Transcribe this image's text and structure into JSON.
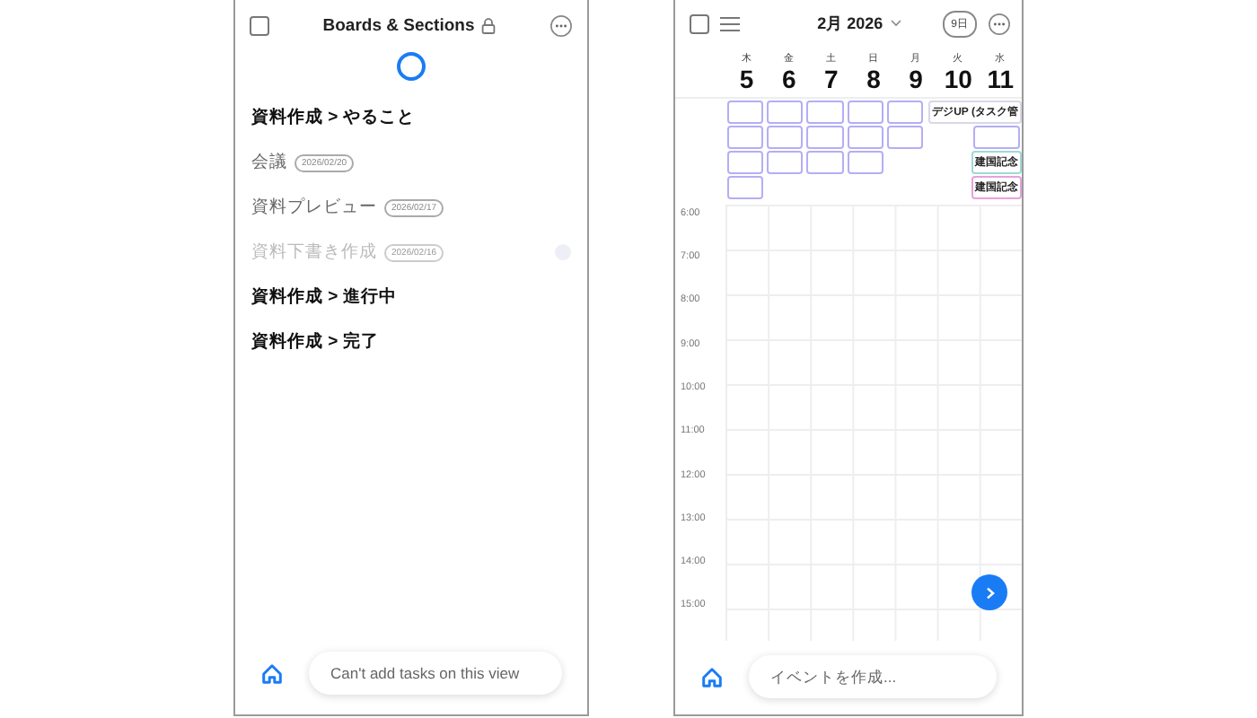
{
  "boards_screen": {
    "select_all": {
      "checked": false
    },
    "title": "Boards & Sections",
    "items": [
      {
        "kind": "section",
        "label": "資料作成 > やること"
      },
      {
        "kind": "task",
        "label": "会議",
        "date": "2026/02/20",
        "dimmed": false
      },
      {
        "kind": "task",
        "label": "資料プレビュー",
        "date": "2026/02/17",
        "dimmed": false
      },
      {
        "kind": "task",
        "label": "資料下書き作成",
        "date": "2026/02/16",
        "dimmed": true
      },
      {
        "kind": "section",
        "label": "資料作成 > 進行中"
      },
      {
        "kind": "section",
        "label": "資料作成 > 完了"
      }
    ],
    "bottom_bar": {
      "placeholder": "Can't add tasks on this view"
    }
  },
  "calendar_screen": {
    "select_all": {
      "checked": false
    },
    "month": "2月 2026",
    "view": "9日",
    "days": [
      {
        "weekday": "木",
        "date": "5"
      },
      {
        "weekday": "金",
        "date": "6"
      },
      {
        "weekday": "土",
        "date": "7"
      },
      {
        "weekday": "日",
        "date": "8"
      },
      {
        "weekday": "月",
        "date": "9"
      },
      {
        "weekday": "火",
        "date": "10"
      },
      {
        "weekday": "水",
        "date": "11"
      }
    ],
    "all_day_rows": [
      [
        {
          "kind": "event",
          "color": "#b4aef6"
        },
        {
          "kind": "event",
          "color": "#b4aef6"
        },
        {
          "kind": "event",
          "color": "#b4aef6"
        },
        {
          "kind": "event",
          "color": "#b4aef6"
        },
        {
          "kind": "event",
          "color": "#b4aef6"
        },
        {
          "kind": "wide",
          "color": "#d9d7e6",
          "text": "デジUP (タスク管"
        }
      ],
      [
        {
          "kind": "event",
          "color": "#b4aef6"
        },
        {
          "kind": "event",
          "color": "#b4aef6"
        },
        {
          "kind": "event",
          "color": "#b4aef6"
        },
        {
          "kind": "event",
          "color": "#b4aef6"
        },
        {
          "kind": "event",
          "color": "#b4aef6"
        },
        {
          "kind": "gap"
        },
        {
          "kind": "event",
          "color": "#b4aef6"
        }
      ],
      [
        {
          "kind": "event",
          "color": "#b4aef6"
        },
        {
          "kind": "event",
          "color": "#b4aef6"
        },
        {
          "kind": "event",
          "color": "#b4aef6"
        },
        {
          "kind": "event",
          "color": "#b4aef6"
        },
        {
          "kind": "gap"
        },
        {
          "kind": "gap"
        },
        {
          "kind": "event",
          "color": "#9fd8d8",
          "text": "建国記念"
        }
      ],
      [
        {
          "kind": "event",
          "color": "#b4aef6"
        },
        {
          "kind": "gap"
        },
        {
          "kind": "gap"
        },
        {
          "kind": "gap"
        },
        {
          "kind": "gap"
        },
        {
          "kind": "gap"
        },
        {
          "kind": "event",
          "color": "#e6a2dc",
          "text": "建国記念"
        }
      ]
    ],
    "hours": [
      "6:00",
      "7:00",
      "8:00",
      "9:00",
      "10:00",
      "11:00",
      "12:00",
      "13:00",
      "14:00",
      "15:00"
    ],
    "bottom_bar": {
      "placeholder": "イベントを作成..."
    }
  }
}
